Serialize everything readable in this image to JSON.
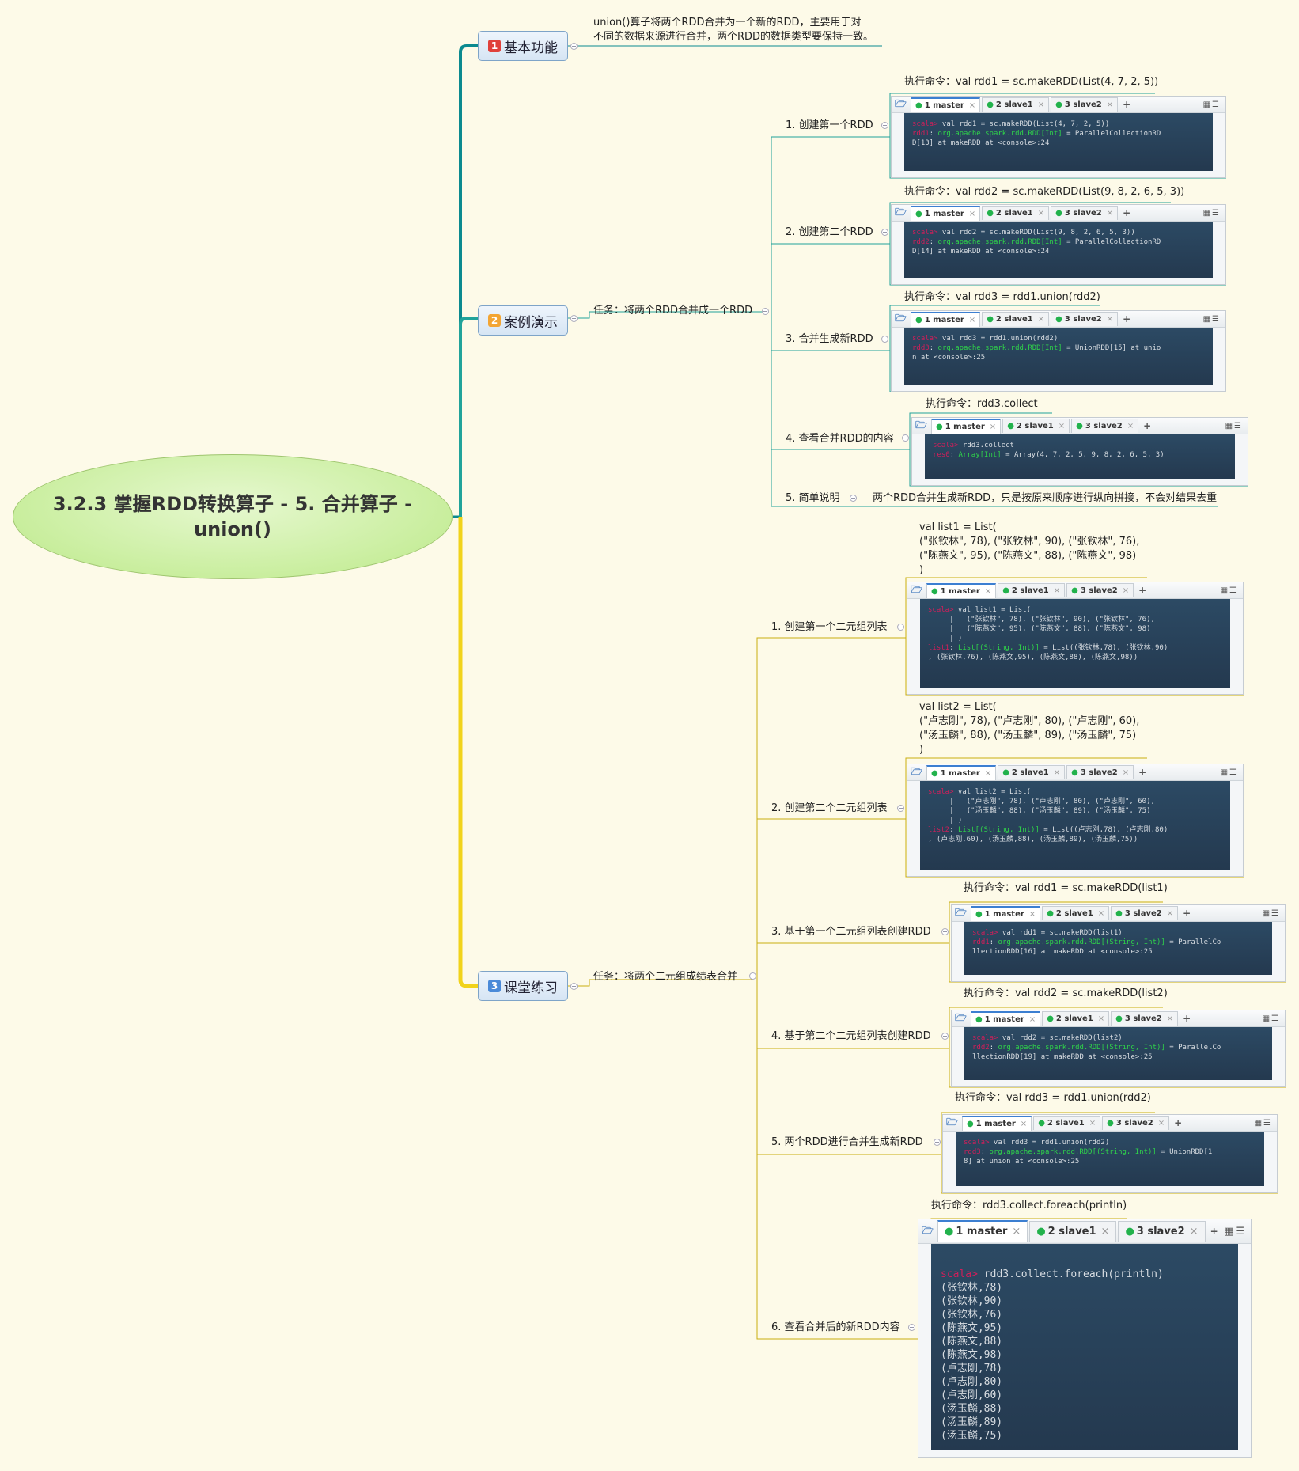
{
  "root": {
    "title": "3.2.3 掌握RDD转换算子 - 5. 合并算子 - union()"
  },
  "topics": [
    {
      "num": "1",
      "label": "基本功能",
      "num_color": "#e0413b"
    },
    {
      "num": "2",
      "label": "案例演示",
      "num_color": "#f3a533"
    },
    {
      "num": "3",
      "label": "课堂练习",
      "num_color": "#4a8ad8"
    }
  ],
  "basic": {
    "lines": [
      "union()算子将两个RDD合并为一个新的RDD，主要用于对",
      "不同的数据来源进行合并，两个RDD的数据类型要保持一致。"
    ]
  },
  "demo": {
    "task": "任务：将两个RDD合并成一个RDD",
    "steps": [
      {
        "label": "1. 创建第一个RDD",
        "command": "执行命令：val rdd1 = sc.makeRDD(List(4, 7, 2, 5))"
      },
      {
        "label": "2. 创建第二个RDD",
        "command": "执行命令：val rdd2 = sc.makeRDD(List(9, 8, 2, 6, 5, 3))"
      },
      {
        "label": "3. 合并生成新RDD",
        "command": "执行命令：val rdd3 = rdd1.union(rdd2)"
      },
      {
        "label": "4. 查看合并RDD的内容",
        "command": "执行命令：rdd3.collect"
      },
      {
        "label": "5. 简单说明",
        "command": "两个RDD合并生成新RDD，只是按原来顺序进行纵向拼接，不会对结果去重"
      }
    ]
  },
  "practice": {
    "task": "任务：将两个二元组成绩表合并",
    "steps": [
      {
        "label": "1. 创建第一个二元组列表",
        "note": [
          "val list1 = List(",
          "  (\"张钦林\", 78), (\"张钦林\", 90), (\"张钦林\", 76),",
          "  (\"陈燕文\", 95), (\"陈燕文\", 88), (\"陈燕文\", 98)",
          ")"
        ]
      },
      {
        "label": "2. 创建第二个二元组列表",
        "note": [
          "val list2 = List(",
          "  (\"卢志刚\", 78), (\"卢志刚\", 80), (\"卢志刚\", 60),",
          "  (\"汤玉麟\", 88), (\"汤玉麟\", 89), (\"汤玉麟\", 75)",
          ")"
        ]
      },
      {
        "label": "3. 基于第一个二元组列表创建RDD",
        "command": "执行命令：val rdd1 = sc.makeRDD(list1)"
      },
      {
        "label": "4. 基于第二个二元组列表创建RDD",
        "command": "执行命令：val rdd2 = sc.makeRDD(list2)"
      },
      {
        "label": "5. 两个RDD进行合并生成新RDD",
        "command": "执行命令：val rdd3 = rdd1.union(rdd2)"
      },
      {
        "label": "6. 查看合并后的新RDD内容",
        "command": "执行命令：rdd3.collect.foreach(println)"
      }
    ]
  },
  "terminal_tabs": [
    "1 master",
    "2 slave1",
    "3 slave2"
  ],
  "terminals": {
    "d1": [
      [
        "p",
        "scala>"
      ],
      [
        "n",
        " val rdd1 = sc.makeRDD(List(4, 7, 2, 5))\n"
      ],
      [
        "p",
        "rdd1"
      ],
      [
        "n",
        ": "
      ],
      [
        "t",
        "org.apache.spark.rdd.RDD[Int]"
      ],
      [
        "n",
        " = ParallelCollectionRD\nD[13] at makeRDD at <console>:24"
      ]
    ],
    "d2": [
      [
        "p",
        "scala>"
      ],
      [
        "n",
        " val rdd2 = sc.makeRDD(List(9, 8, 2, 6, 5, 3))\n"
      ],
      [
        "p",
        "rdd2"
      ],
      [
        "n",
        ": "
      ],
      [
        "t",
        "org.apache.spark.rdd.RDD[Int]"
      ],
      [
        "n",
        " = ParallelCollectionRD\nD[14] at makeRDD at <console>:24"
      ]
    ],
    "d3": [
      [
        "p",
        "scala>"
      ],
      [
        "n",
        " val rdd3 = rdd1.union(rdd2)\n"
      ],
      [
        "p",
        "rdd3"
      ],
      [
        "n",
        ": "
      ],
      [
        "t",
        "org.apache.spark.rdd.RDD[Int]"
      ],
      [
        "n",
        " = UnionRDD[15] at unio\nn at <console>:25"
      ]
    ],
    "d4": [
      [
        "p",
        "scala>"
      ],
      [
        "n",
        " rdd3.collect\n"
      ],
      [
        "p",
        "res0"
      ],
      [
        "n",
        ": "
      ],
      [
        "t",
        "Array[Int]"
      ],
      [
        "n",
        " = Array(4, 7, 2, 5, 9, 8, 2, 6, 5, 3)"
      ]
    ],
    "p1": [
      [
        "p",
        "scala>"
      ],
      [
        "n",
        " val list1 = List(\n     |   (\"张钦林\", 78), (\"张钦林\", 90), (\"张钦林\", 76),\n     |   (\"陈燕文\", 95), (\"陈燕文\", 88), (\"陈燕文\", 98)\n     | )\n"
      ],
      [
        "p",
        "list1"
      ],
      [
        "n",
        ": "
      ],
      [
        "t",
        "List[(String, Int)]"
      ],
      [
        "n",
        " = List((张钦林,78), (张钦林,90)\n, (张钦林,76), (陈燕文,95), (陈燕文,88), (陈燕文,98))"
      ]
    ],
    "p2": [
      [
        "p",
        "scala>"
      ],
      [
        "n",
        " val list2 = List(\n     |   (\"卢志刚\", 78), (\"卢志刚\", 80), (\"卢志刚\", 60),\n     |   (\"汤玉麟\", 88), (\"汤玉麟\", 89), (\"汤玉麟\", 75)\n     | )\n"
      ],
      [
        "p",
        "list2"
      ],
      [
        "n",
        ": "
      ],
      [
        "t",
        "List[(String, Int)]"
      ],
      [
        "n",
        " = List((卢志刚,78), (卢志刚,80)\n, (卢志刚,60), (汤玉麟,88), (汤玉麟,89), (汤玉麟,75))"
      ]
    ],
    "p3": [
      [
        "p",
        "scala>"
      ],
      [
        "n",
        " val rdd1 = sc.makeRDD(list1)\n"
      ],
      [
        "p",
        "rdd1"
      ],
      [
        "n",
        ": "
      ],
      [
        "t",
        "org.apache.spark.rdd.RDD[(String, Int)]"
      ],
      [
        "n",
        " = ParallelCo\nllectionRDD[16] at makeRDD at <console>:25"
      ]
    ],
    "p4": [
      [
        "p",
        "scala>"
      ],
      [
        "n",
        " val rdd2 = sc.makeRDD(list2)\n"
      ],
      [
        "p",
        "rdd2"
      ],
      [
        "n",
        ": "
      ],
      [
        "t",
        "org.apache.spark.rdd.RDD[(String, Int)]"
      ],
      [
        "n",
        " = ParallelCo\nllectionRDD[19] at makeRDD at <console>:25"
      ]
    ],
    "p5": [
      [
        "p",
        "scala>"
      ],
      [
        "n",
        " val rdd3 = rdd1.union(rdd2)\n"
      ],
      [
        "p",
        "rdd3"
      ],
      [
        "n",
        ": "
      ],
      [
        "t",
        "org.apache.spark.rdd.RDD[(String, Int)]"
      ],
      [
        "n",
        " = UnionRDD[1\n8] at union at <console>:25"
      ]
    ],
    "p6": [
      [
        "p",
        "scala>"
      ],
      [
        "n",
        " rdd3.collect.foreach(println)\n(张钦林,78)\n(张钦林,90)\n(张钦林,76)\n(陈燕文,95)\n(陈燕文,88)\n(陈燕文,98)\n(卢志刚,78)\n(卢志刚,80)\n(卢志刚,60)\n(汤玉麟,88)\n(汤玉麟,89)\n(汤玉麟,75)"
      ]
    ]
  }
}
